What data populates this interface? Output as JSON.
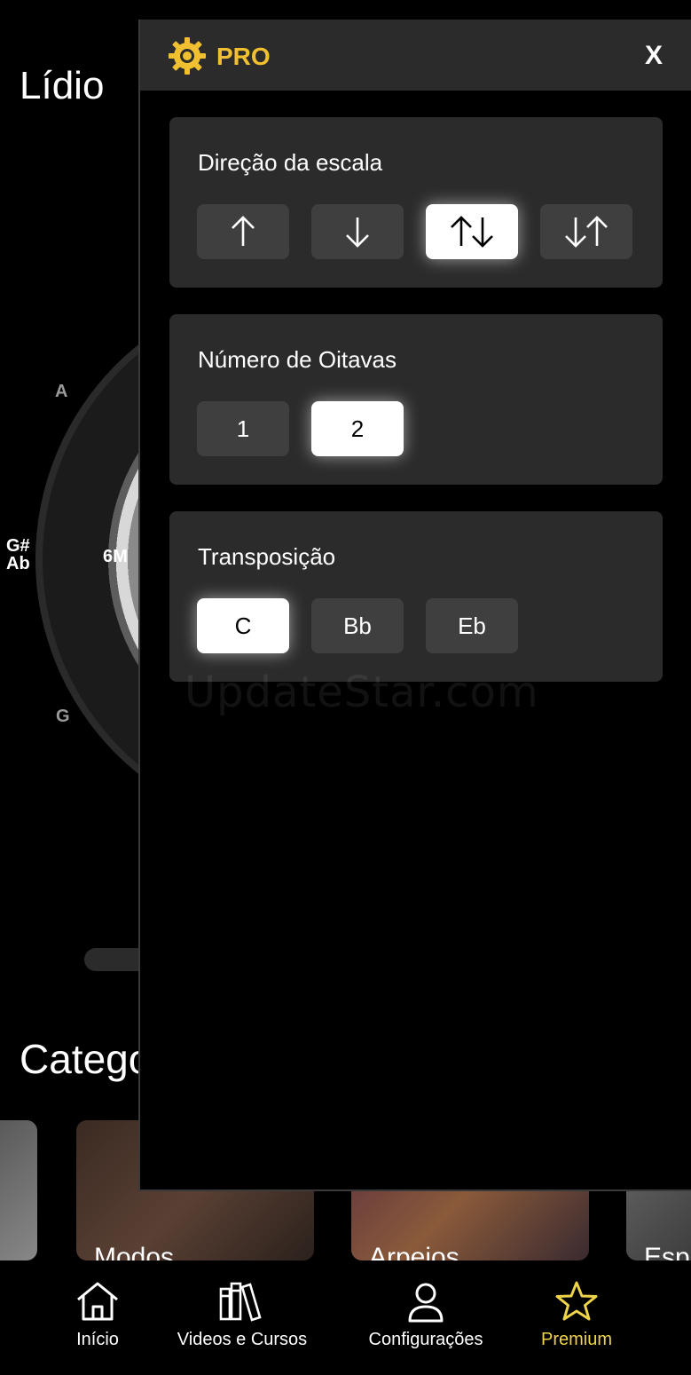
{
  "background": {
    "title": "Lídio",
    "wheel_notes": [
      "A",
      "G#",
      "Ab",
      "G",
      "6M"
    ],
    "categories_heading": "Catego",
    "category_cards": [
      "Modos",
      "Arpejos",
      "Esp"
    ]
  },
  "watermark": "UpdateStar.com",
  "panel": {
    "header": {
      "title": "PRO",
      "close_label": "X"
    },
    "sections": [
      {
        "title": "Direção da escala",
        "options": [
          "up",
          "down",
          "up-down",
          "down-up"
        ],
        "selected": "up-down"
      },
      {
        "title": "Número de Oitavas",
        "options": [
          "1",
          "2"
        ],
        "selected": "2"
      },
      {
        "title": "Transposição",
        "options": [
          "C",
          "Bb",
          "Eb"
        ],
        "selected": "C"
      }
    ]
  },
  "bottom_nav": [
    {
      "label": "Início",
      "icon": "home-icon"
    },
    {
      "label": "Videos e Cursos",
      "icon": "books-icon"
    },
    {
      "label": "Configurações",
      "icon": "user-icon"
    },
    {
      "label": "Premium",
      "icon": "star-icon",
      "active": true
    }
  ],
  "colors": {
    "accent": "#f0c030",
    "premium": "#f0d448",
    "panel": "#2b2b2b",
    "button": "#3f3f3f"
  }
}
